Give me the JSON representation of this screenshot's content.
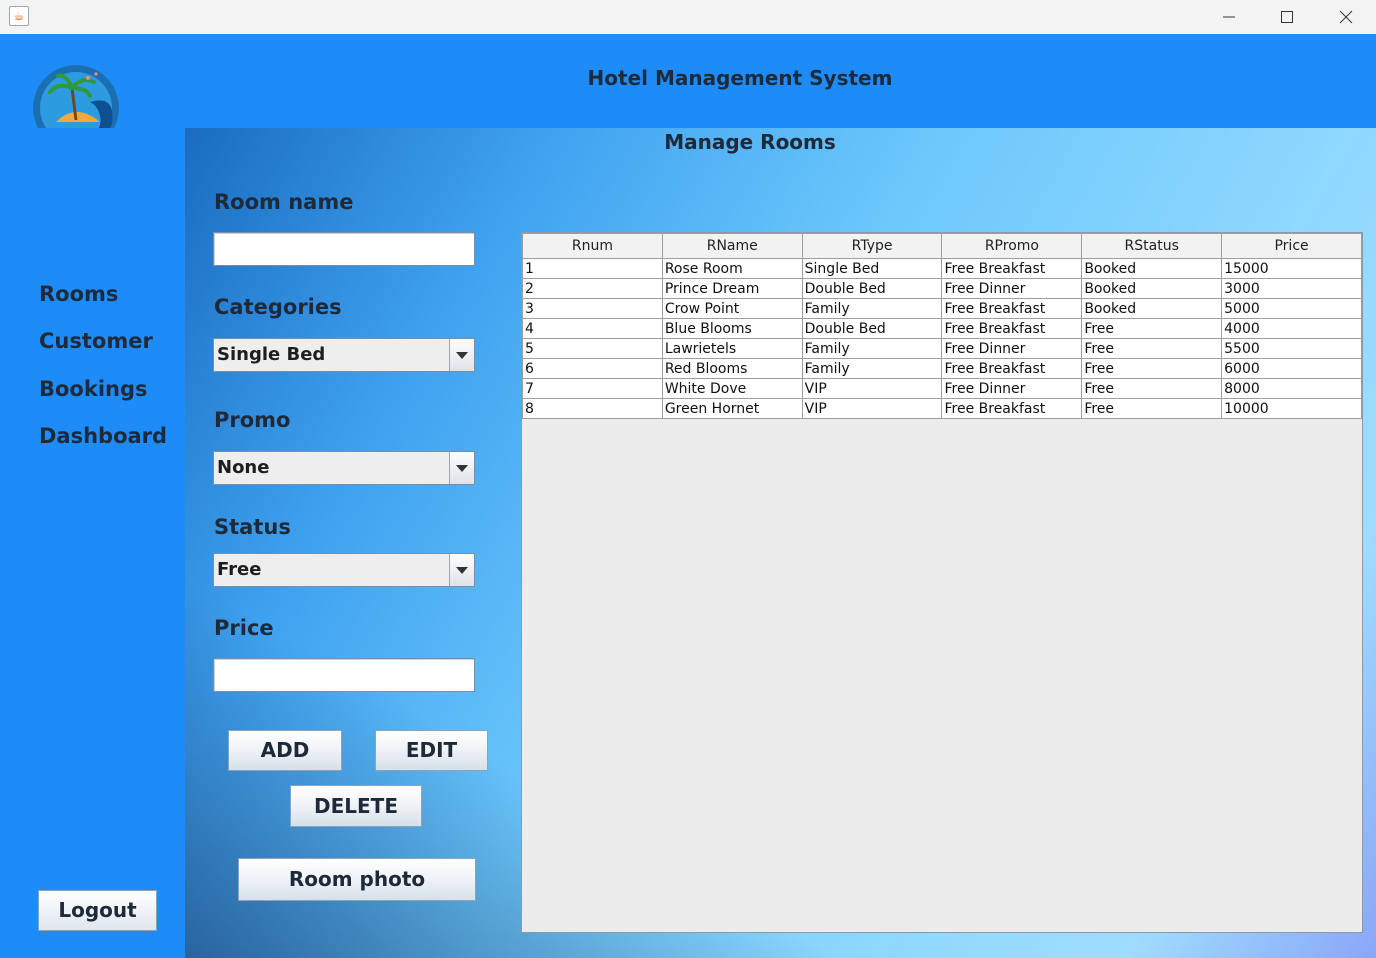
{
  "window": {
    "app_icon": "java-cup-icon"
  },
  "header": {
    "title": "Hotel Management System",
    "logo": "island-logo"
  },
  "sidebar": {
    "items": [
      {
        "label": "Rooms"
      },
      {
        "label": "Customer"
      },
      {
        "label": "Bookings"
      },
      {
        "label": "Dashboard"
      }
    ],
    "logout_label": "Logout"
  },
  "form": {
    "title": "Manage Rooms",
    "room_name_label": "Room name",
    "room_name_value": "",
    "categories_label": "Categories",
    "categories_value": "Single Bed",
    "promo_label": "Promo",
    "promo_value": "None",
    "status_label": "Status",
    "status_value": "Free",
    "price_label": "Price",
    "price_value": "",
    "add_label": "ADD",
    "edit_label": "EDIT",
    "delete_label": "DELETE",
    "photo_label": "Room photo"
  },
  "table": {
    "headers": [
      "Rnum",
      "RName",
      "RType",
      "RPromo",
      "RStatus",
      "Price"
    ],
    "rows": [
      [
        "1",
        "Rose Room",
        "Single Bed",
        "Free Breakfast",
        "Booked",
        "15000"
      ],
      [
        "2",
        "Prince Dream",
        "Double Bed",
        "Free Dinner",
        "Booked",
        "3000"
      ],
      [
        "3",
        "Crow Point",
        "Family",
        "Free Breakfast",
        "Booked",
        "5000"
      ],
      [
        "4",
        "Blue Blooms",
        "Double Bed",
        "Free Breakfast",
        "Free",
        "4000"
      ],
      [
        "5",
        "Lawrietels",
        "Family",
        "Free Dinner",
        "Free",
        "5500"
      ],
      [
        "6",
        "Red Blooms",
        "Family",
        "Free Breakfast",
        "Free",
        "6000"
      ],
      [
        "7",
        "White Dove",
        "VIP",
        "Free Dinner",
        "Free",
        "8000"
      ],
      [
        "8",
        "Green Hornet",
        "VIP",
        "Free Breakfast",
        "Free",
        "10000"
      ]
    ]
  }
}
